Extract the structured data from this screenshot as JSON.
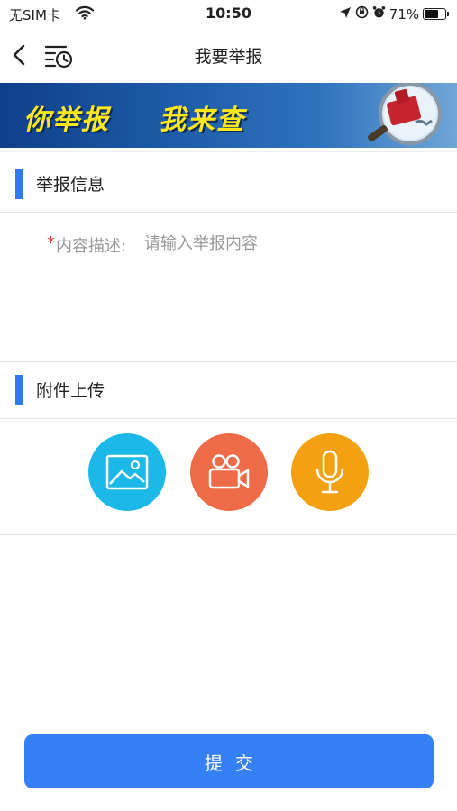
{
  "status_bar": {
    "carrier": "无SIM卡",
    "time": "10:50",
    "battery_percent": "71%",
    "battery_level": 0.71
  },
  "nav": {
    "title": "我要举报",
    "back_icon": "chevron-left-icon",
    "history_icon": "list-clock-icon"
  },
  "banner": {
    "slogan_part1": "你举报",
    "slogan_part2": "我来查",
    "text_color": "#ffe71a"
  },
  "sections": {
    "report_info": "举报信息",
    "attachments": "附件上传"
  },
  "content_field": {
    "required_mark": "*",
    "label": "内容描述:",
    "value": "",
    "placeholder": "请输入举报内容"
  },
  "uploads": [
    {
      "type": "image",
      "icon": "image-icon",
      "color": "#1bb8e8"
    },
    {
      "type": "video",
      "icon": "video-camera-icon",
      "color": "#ee6b47"
    },
    {
      "type": "audio",
      "icon": "microphone-icon",
      "color": "#f3a012"
    }
  ],
  "submit": {
    "label": "提交",
    "color": "#3580f5"
  },
  "accent_color": "#2e7bf0"
}
